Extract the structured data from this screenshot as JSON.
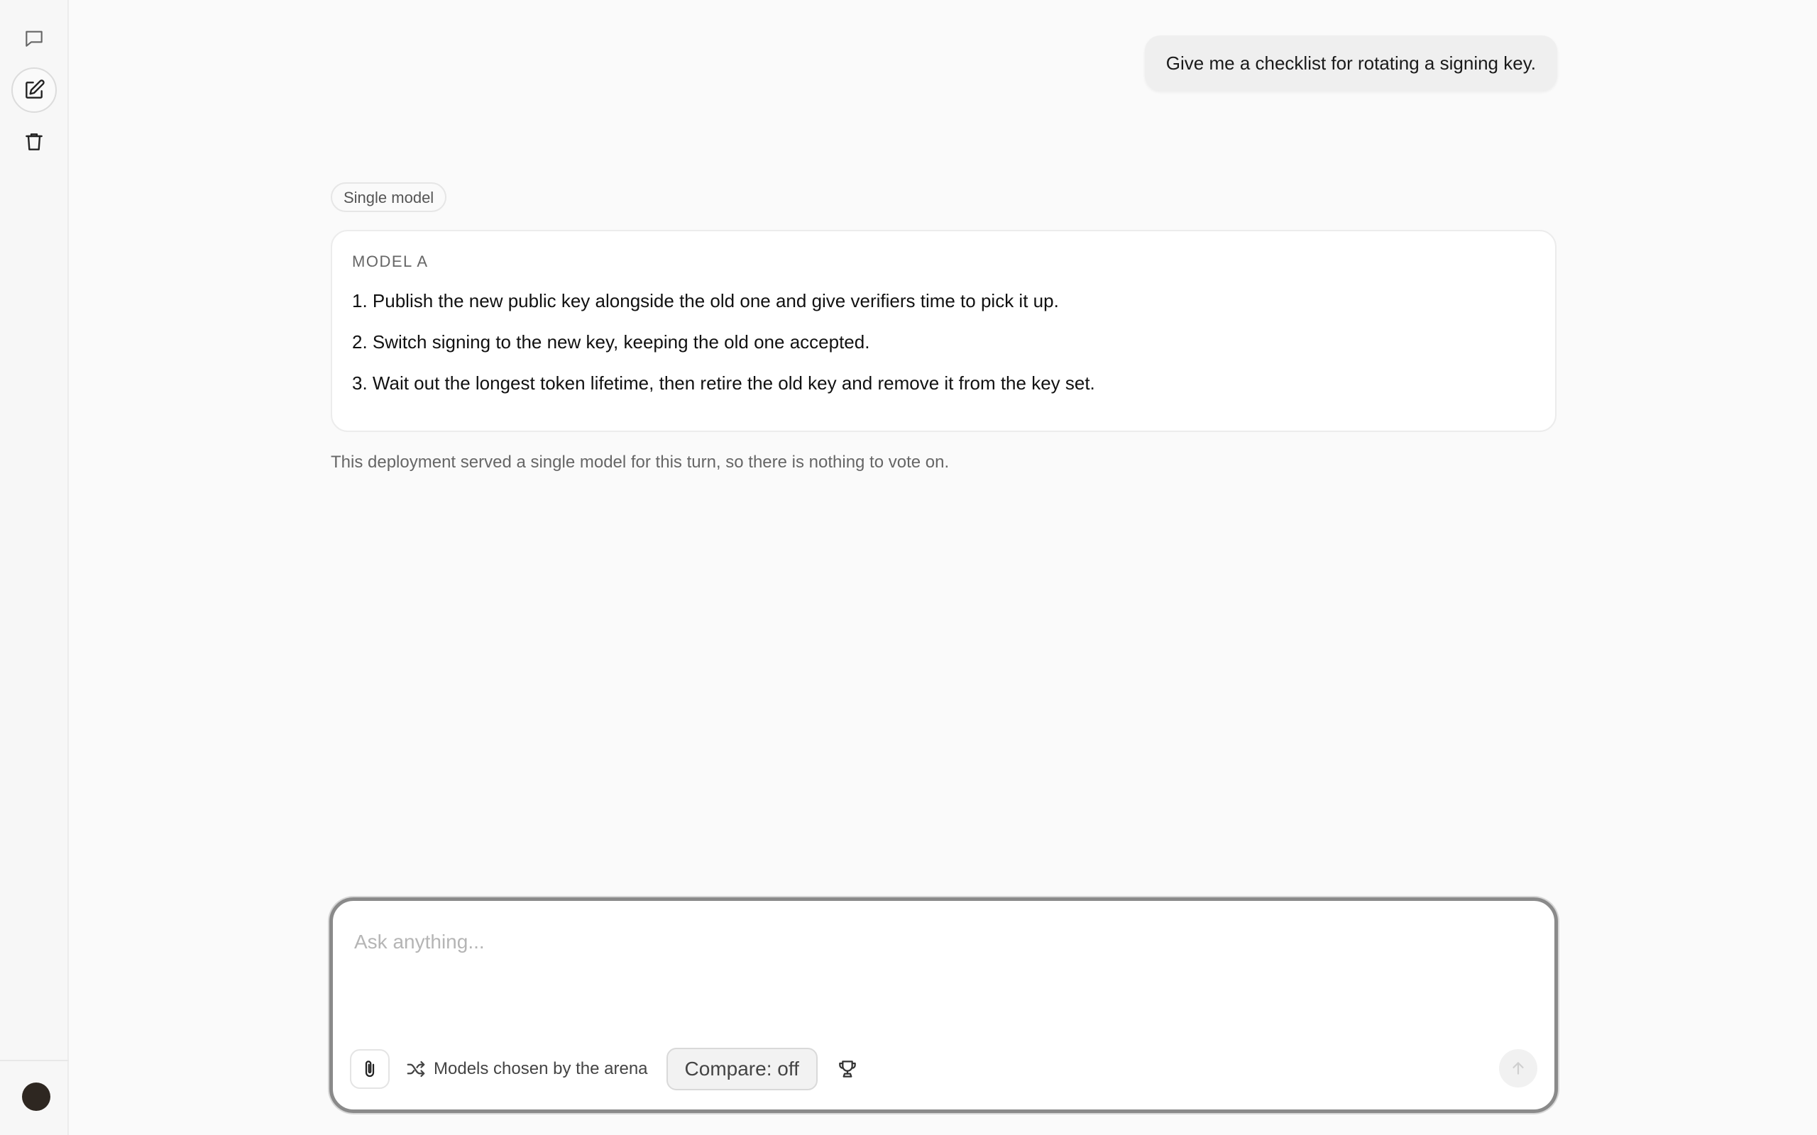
{
  "sidebar": {
    "items": [
      {
        "icon": "chat-bubble-icon"
      },
      {
        "icon": "edit-icon",
        "active": true
      },
      {
        "icon": "trash-icon"
      }
    ],
    "avatar_color": "#2e2721"
  },
  "conversation": {
    "user_message": "Give me a checklist for rotating a signing key.",
    "mode_badge": "Single model",
    "response": {
      "label": "MODEL A",
      "items": [
        "1. Publish the new public key alongside the old one and give verifiers time to pick it up.",
        "2. Switch signing to the new key, keeping the old one accepted.",
        "3. Wait out the longest token lifetime, then retire the old key and remove it from the key set."
      ]
    },
    "notice": "This deployment served a single model for this turn, so there is nothing to vote on."
  },
  "composer": {
    "placeholder": "Ask anything...",
    "value": "",
    "models_label": "Models chosen by the arena",
    "compare_label": "Compare: off"
  },
  "colors": {
    "background": "#fafafa",
    "sidebar": "#f7f7f7",
    "user_bubble": "#efefef",
    "composer_border": "#8a8a8a"
  }
}
